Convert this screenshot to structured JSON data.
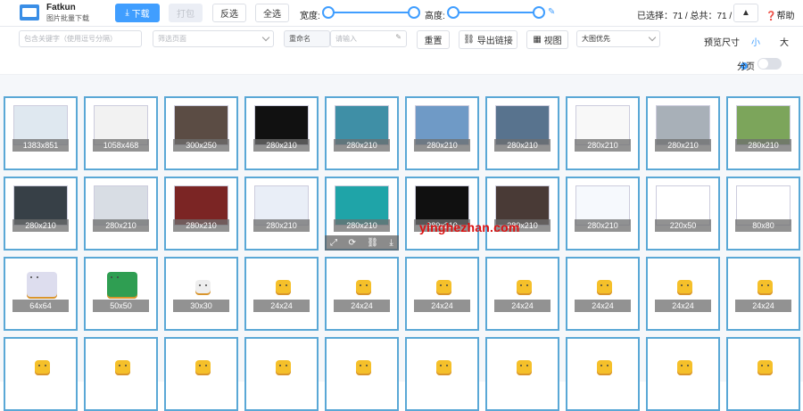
{
  "app": {
    "title": "Fatkun",
    "subtitle": "图片批量下载"
  },
  "toolbar": {
    "download": "下载",
    "zip": "打包",
    "invert": "反选",
    "select_all": "全选",
    "width_label": "宽度:",
    "height_label": "高度:",
    "selection_status": "已选择：71 / 总共：71 /",
    "help": "帮助"
  },
  "filters": {
    "keyword_placeholder": "包含关键字（使用逗号分隔）",
    "page_filter_placeholder": "筛选页面",
    "rename": "重命名",
    "rename_placeholder": "请输入",
    "reset": "重置",
    "export_links": "导出链接",
    "view": "视图",
    "sort": "大图优先",
    "preview_size": "预览尺寸",
    "small": "小",
    "large": "大",
    "paging": "分页"
  },
  "images": [
    {
      "size": "1383x851"
    },
    {
      "size": "1058x468"
    },
    {
      "size": "300x250"
    },
    {
      "size": "280x210"
    },
    {
      "size": "280x210"
    },
    {
      "size": "280x210"
    },
    {
      "size": "280x210"
    },
    {
      "size": "280x210"
    },
    {
      "size": "280x210"
    },
    {
      "size": "280x210"
    },
    {
      "size": "280x210"
    },
    {
      "size": "280x210"
    },
    {
      "size": "280x210"
    },
    {
      "size": "280x210"
    },
    {
      "size": "280x210"
    },
    {
      "size": "280x210"
    },
    {
      "size": "280x210"
    },
    {
      "size": "280x210"
    },
    {
      "size": "220x50"
    },
    {
      "size": "80x80"
    },
    {
      "size": "64x64"
    },
    {
      "size": "50x50"
    },
    {
      "size": "30x30"
    },
    {
      "size": "24x24"
    },
    {
      "size": "24x24"
    },
    {
      "size": "24x24"
    },
    {
      "size": "24x24"
    },
    {
      "size": "24x24"
    },
    {
      "size": "24x24"
    },
    {
      "size": "24x24"
    },
    {
      "size": ""
    },
    {
      "size": ""
    },
    {
      "size": ""
    },
    {
      "size": ""
    },
    {
      "size": ""
    },
    {
      "size": ""
    },
    {
      "size": ""
    },
    {
      "size": ""
    },
    {
      "size": ""
    },
    {
      "size": ""
    }
  ],
  "watermark": "yinghezhan.com"
}
